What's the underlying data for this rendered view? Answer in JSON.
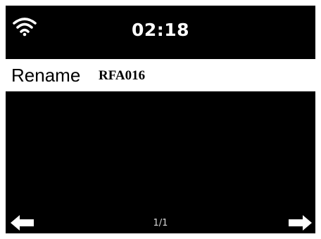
{
  "status_bar": {
    "icon": "wifi-icon",
    "time": "02:18"
  },
  "menu": {
    "items": [
      {
        "label": "Rename",
        "value": "RFA016",
        "selected": true
      }
    ]
  },
  "footer": {
    "left_icon": "arrow-left-icon",
    "page": "1/1",
    "right_icon": "arrow-right-icon"
  },
  "colors": {
    "screen_bg": "#000000",
    "highlight_bg": "#ffffff",
    "text_on_dark": "#ffffff",
    "text_on_highlight": "#000000"
  }
}
